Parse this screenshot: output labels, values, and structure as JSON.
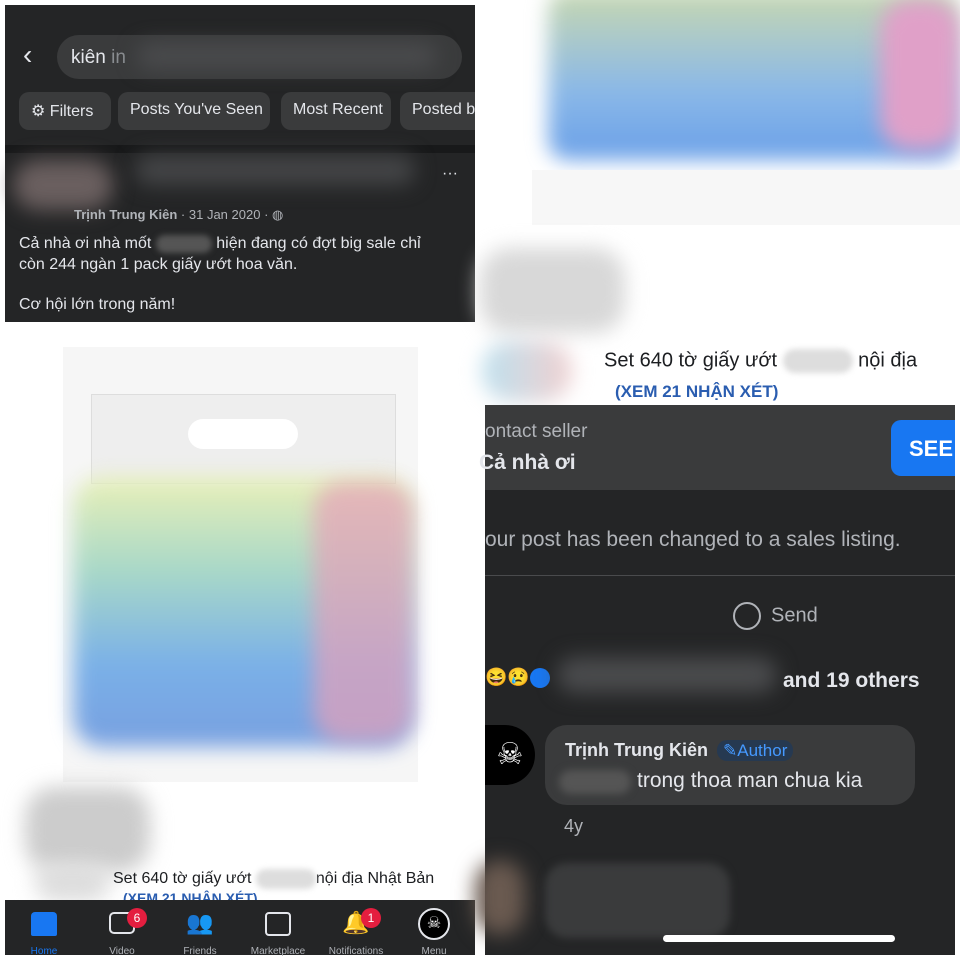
{
  "search": {
    "query": "kiên",
    "scope_prefix": "in"
  },
  "filters": [
    {
      "label": "Filters",
      "icon": "sliders-icon"
    },
    {
      "label": "Posts You've Seen"
    },
    {
      "label": "Most Recent"
    },
    {
      "label": "Posted b"
    }
  ],
  "post": {
    "author": "Trịnh Trung Kiên",
    "date": "31 Jan 2020",
    "separator": "·",
    "line1a": "Cả nhà ơi nhà mốt",
    "line1b": "hiện đang có đợt big sale chỉ",
    "line2": "còn 244 ngàn 1 pack giấy ướt hoa văn.",
    "line3": "Cơ hội lớn trong năm!",
    "more": "···"
  },
  "listing_left": {
    "title_a": "Set 640 tờ giấy ướt",
    "title_b": "nội địa Nhật Bản",
    "link": "(XEM 21 NHẬN XÉT)"
  },
  "nav": [
    {
      "label": "Home",
      "icon": "home-icon"
    },
    {
      "label": "Video",
      "icon": "video-icon",
      "badge": "6"
    },
    {
      "label": "Friends",
      "icon": "friends-icon"
    },
    {
      "label": "Marketplace",
      "icon": "marketplace-icon"
    },
    {
      "label": "Notifications",
      "icon": "bell-icon",
      "badge": "1"
    },
    {
      "label": "Menu",
      "icon": "avatar-menu-icon"
    }
  ],
  "listing_right": {
    "title_a": "Set 640 tờ giấy ướt",
    "title_b": "nội địa",
    "link": "(XEM 21 NHẬN XÉT)"
  },
  "contact": {
    "label": "ontact seller",
    "message": "Cả nhà ơi",
    "button": "SEE"
  },
  "notice": "our post has been changed to a sales listing.",
  "send": "Send",
  "reactions": {
    "others": "and 19 others"
  },
  "comment": {
    "author": "Trịnh Trung Kiên",
    "badge": "Author",
    "text": "trong thoa man chua kia",
    "time": "4y"
  },
  "colors": {
    "accent": "#1877f2",
    "link": "#2a5db0",
    "dark": "#242526"
  }
}
